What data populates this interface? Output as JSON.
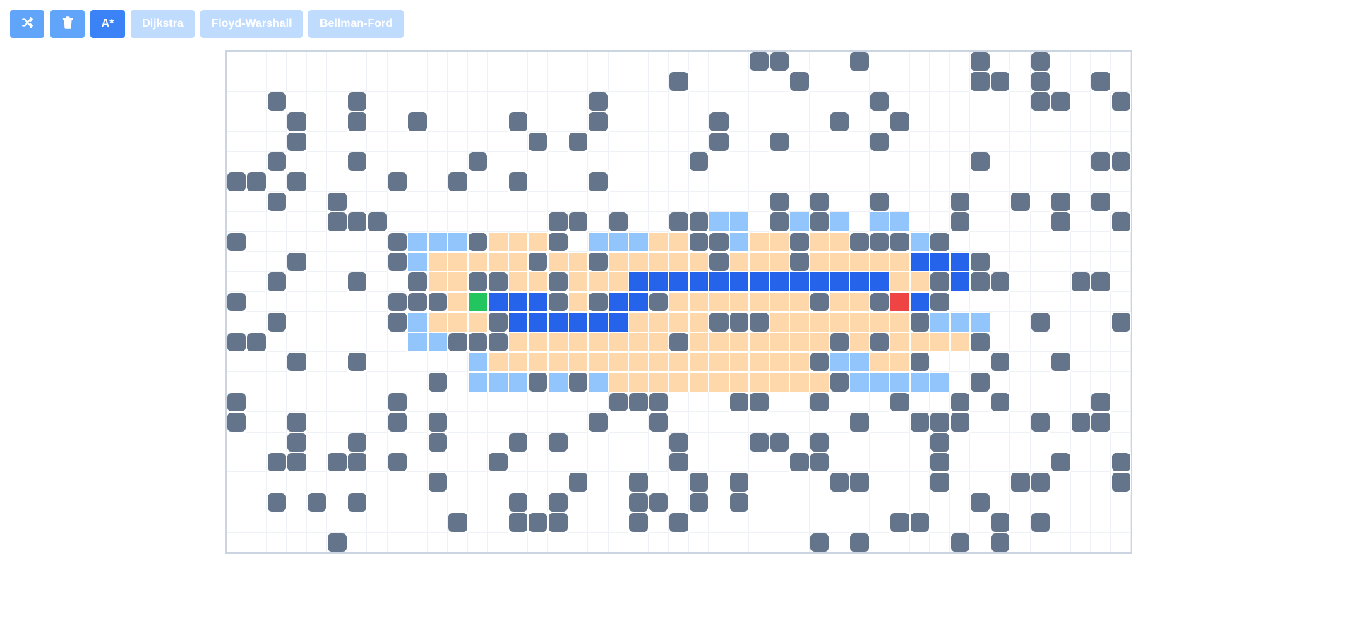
{
  "toolbar": {
    "shuffle_icon": "shuffle-icon",
    "trash_icon": "trash-icon",
    "astar_label": "A*",
    "dijkstra_label": "Dijkstra",
    "floyd_label": "Floyd-Warshall",
    "bellman_label": "Bellman-Ford"
  },
  "colors": {
    "wall": "#64748b",
    "visited": "#fed7aa",
    "frontier": "#93c5fd",
    "path": "#2563eb",
    "start": "#22c55e",
    "end": "#ef4444",
    "accent": "#3b82f6"
  },
  "grid": {
    "cols": 45,
    "rows": 25,
    "legend": "# wall, v visited, f frontier, p path, S start, E end, . empty",
    "cells": [
      "..........................##....#......#..#....",
      ".....................................",
      "",
      "",
      "",
      "",
      "",
      "",
      "",
      "",
      "",
      "",
      "",
      "",
      "",
      "",
      "",
      "",
      "",
      "",
      "",
      "",
      "",
      "",
      ""
    ]
  }
}
